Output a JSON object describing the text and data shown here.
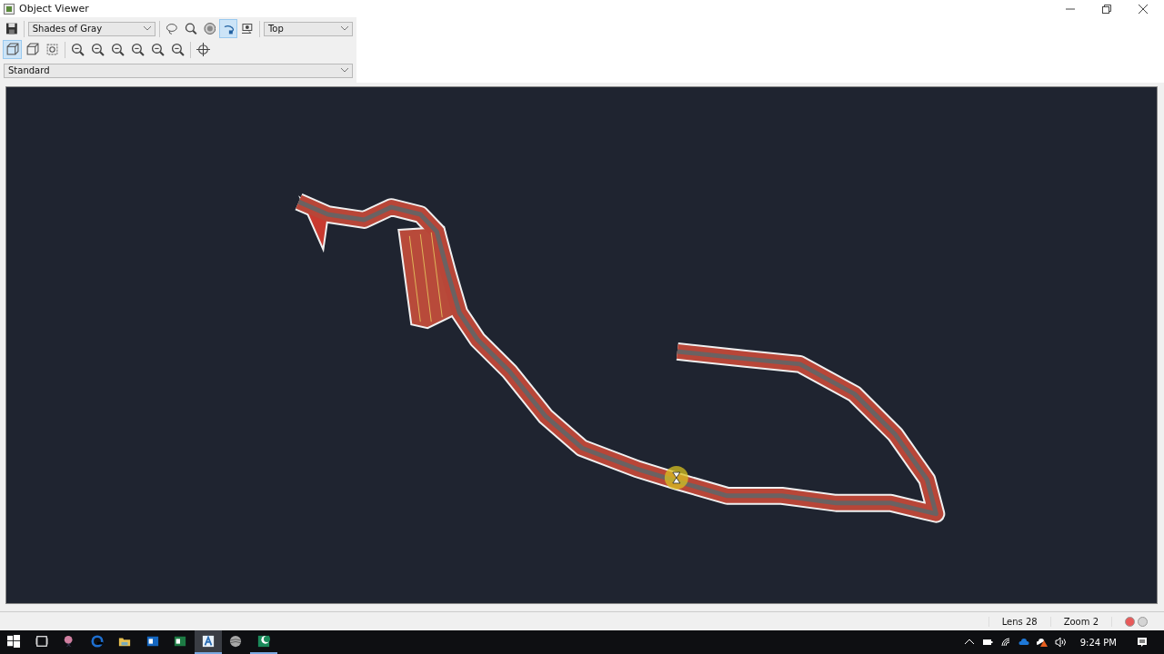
{
  "window": {
    "title": "Object Viewer"
  },
  "toolbar": {
    "style_dropdown": {
      "value": "Shades of Gray"
    },
    "view_dropdown": {
      "value": "Top"
    },
    "tools": [
      {
        "kind": "lasso",
        "selected": false
      },
      {
        "kind": "search",
        "selected": false
      },
      {
        "kind": "render",
        "selected": false
      },
      {
        "kind": "orbit",
        "selected": true
      },
      {
        "kind": "camera",
        "selected": false
      }
    ]
  },
  "view_tools": [
    {
      "kind": "cube",
      "selected": true
    },
    {
      "kind": "cube",
      "selected": false
    },
    {
      "kind": "frame",
      "selected": false
    },
    {
      "kind": "zoom",
      "selected": false
    },
    {
      "kind": "zoom",
      "selected": false
    },
    {
      "kind": "zoom",
      "selected": false
    },
    {
      "kind": "zoom",
      "selected": false
    },
    {
      "kind": "zoom",
      "selected": false
    },
    {
      "kind": "zoom",
      "selected": false
    },
    {
      "kind": "target",
      "selected": false
    }
  ],
  "visual_style_dropdown": {
    "value": "Standard"
  },
  "viewport": {
    "kind": "corridor"
  },
  "status_bar": {
    "lens": "Lens 28",
    "zoom": "Zoom 2",
    "indicators": [
      {
        "color": "#e85a5a"
      },
      {
        "color": "#d4d4d4"
      }
    ]
  },
  "taskbar": {
    "apps": [
      {
        "kind": "start",
        "selected": false,
        "running": false
      },
      {
        "kind": "taskview",
        "selected": false,
        "running": false
      },
      {
        "kind": "snip",
        "selected": false,
        "running": false
      },
      {
        "kind": "browser",
        "selected": false,
        "running": false
      },
      {
        "kind": "folder",
        "selected": false,
        "running": false
      },
      {
        "kind": "mail",
        "selected": false,
        "running": false
      },
      {
        "kind": "sheet",
        "selected": false,
        "running": false
      },
      {
        "kind": "cad",
        "selected": true,
        "running": true
      },
      {
        "kind": "globe",
        "selected": false,
        "running": false
      },
      {
        "kind": "civil",
        "selected": false,
        "running": true
      }
    ],
    "time": "9:24 PM"
  }
}
